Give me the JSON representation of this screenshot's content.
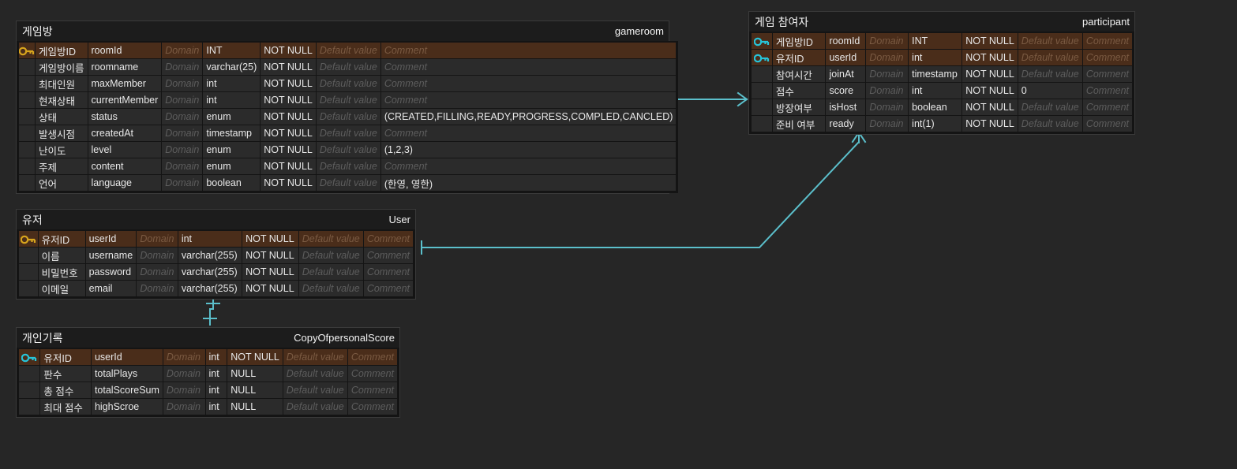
{
  "canvas": {
    "background": "#262626",
    "relation_color": "#5bbfcb",
    "pk_row_color": "#4a2d1a",
    "row_color": "#2b2b2b",
    "key_icon_gold": "#d8a51d",
    "key_icon_cyan": "#27c4d9"
  },
  "column_headers": {
    "domain": "Domain",
    "default_value": "Default value",
    "comment": "Comment"
  },
  "entities": [
    {
      "id": "gameroom",
      "logical_name": "게임방",
      "physical_name": "gameroom",
      "columns": [
        {
          "key": "pk-gold",
          "logical": "게임방ID",
          "physical": "roomId",
          "domain": "Domain",
          "type": "INT",
          "nullable": "NOT NULL",
          "default": "Default value",
          "default_is_placeholder": true,
          "comment": "Comment",
          "comment_is_placeholder": true
        },
        {
          "key": "none",
          "logical": "게임방이름",
          "physical": "roomname",
          "domain": "Domain",
          "type": "varchar(25)",
          "nullable": "NOT NULL",
          "default": "Default value",
          "default_is_placeholder": true,
          "comment": "Comment",
          "comment_is_placeholder": true
        },
        {
          "key": "none",
          "logical": "최대인원",
          "physical": "maxMember",
          "domain": "Domain",
          "type": "int",
          "nullable": "NOT NULL",
          "default": "Default value",
          "default_is_placeholder": true,
          "comment": "Comment",
          "comment_is_placeholder": true
        },
        {
          "key": "none",
          "logical": "현재상태",
          "physical": "currentMember",
          "domain": "Domain",
          "type": "int",
          "nullable": "NOT NULL",
          "default": "Default value",
          "default_is_placeholder": true,
          "comment": "Comment",
          "comment_is_placeholder": true
        },
        {
          "key": "none",
          "logical": "상태",
          "physical": "status",
          "domain": "Domain",
          "type": "enum",
          "nullable": "NOT NULL",
          "default": "Default value",
          "default_is_placeholder": true,
          "comment": "(CREATED,FILLING,READY,PROGRESS,COMPLED,CANCLED)",
          "comment_is_placeholder": false
        },
        {
          "key": "none",
          "logical": "발생시점",
          "physical": "createdAt",
          "domain": "Domain",
          "type": "timestamp",
          "nullable": "NOT NULL",
          "default": "Default value",
          "default_is_placeholder": true,
          "comment": "Comment",
          "comment_is_placeholder": true
        },
        {
          "key": "none",
          "logical": "난이도",
          "physical": "level",
          "domain": "Domain",
          "type": "enum",
          "nullable": "NOT NULL",
          "default": "Default value",
          "default_is_placeholder": true,
          "comment": "(1,2,3)",
          "comment_is_placeholder": false
        },
        {
          "key": "none",
          "logical": "주제",
          "physical": "content",
          "domain": "Domain",
          "type": "enum",
          "nullable": "NOT NULL",
          "default": "Default value",
          "default_is_placeholder": true,
          "comment": "Comment",
          "comment_is_placeholder": true
        },
        {
          "key": "none",
          "logical": "언어",
          "physical": "language",
          "domain": "Domain",
          "type": "boolean",
          "nullable": "NOT NULL",
          "default": "Default value",
          "default_is_placeholder": true,
          "comment": "(한영, 영한)",
          "comment_is_placeholder": false
        }
      ]
    },
    {
      "id": "participant",
      "logical_name": "게임 참여자",
      "physical_name": "participant",
      "columns": [
        {
          "key": "pk-cyan",
          "logical": "게임방ID",
          "physical": "roomId",
          "domain": "Domain",
          "type": "INT",
          "nullable": "NOT NULL",
          "default": "Default value",
          "default_is_placeholder": true,
          "comment": "Comment",
          "comment_is_placeholder": true
        },
        {
          "key": "pk-cyan",
          "logical": "유저ID",
          "physical": "userId",
          "domain": "Domain",
          "type": "int",
          "nullable": "NOT NULL",
          "default": "Default value",
          "default_is_placeholder": true,
          "comment": "Comment",
          "comment_is_placeholder": true
        },
        {
          "key": "none",
          "logical": "참여시간",
          "physical": "joinAt",
          "domain": "Domain",
          "type": "timestamp",
          "nullable": "NOT NULL",
          "default": "Default value",
          "default_is_placeholder": true,
          "comment": "Comment",
          "comment_is_placeholder": true
        },
        {
          "key": "none",
          "logical": "점수",
          "physical": "score",
          "domain": "Domain",
          "type": "int",
          "nullable": "NOT NULL",
          "default": "0",
          "default_is_placeholder": false,
          "comment": "Comment",
          "comment_is_placeholder": true
        },
        {
          "key": "none",
          "logical": "방장여부",
          "physical": "isHost",
          "domain": "Domain",
          "type": "boolean",
          "nullable": "NOT NULL",
          "default": "Default value",
          "default_is_placeholder": true,
          "comment": "Comment",
          "comment_is_placeholder": true
        },
        {
          "key": "none",
          "logical": "준비 여부",
          "physical": "ready",
          "domain": "Domain",
          "type": "int(1)",
          "nullable": "NOT NULL",
          "default": "Default value",
          "default_is_placeholder": true,
          "comment": "Comment",
          "comment_is_placeholder": true
        }
      ]
    },
    {
      "id": "user",
      "logical_name": "유저",
      "physical_name": "User",
      "columns": [
        {
          "key": "pk-gold",
          "logical": "유저ID",
          "physical": "userId",
          "domain": "Domain",
          "type": "int",
          "nullable": "NOT NULL",
          "default": "Default value",
          "default_is_placeholder": true,
          "comment": "Comment",
          "comment_is_placeholder": true
        },
        {
          "key": "none",
          "logical": "이름",
          "physical": "username",
          "domain": "Domain",
          "type": "varchar(255)",
          "nullable": "NOT NULL",
          "default": "Default value",
          "default_is_placeholder": true,
          "comment": "Comment",
          "comment_is_placeholder": true
        },
        {
          "key": "none",
          "logical": "비밀번호",
          "physical": "password",
          "domain": "Domain",
          "type": "varchar(255)",
          "nullable": "NOT NULL",
          "default": "Default value",
          "default_is_placeholder": true,
          "comment": "Comment",
          "comment_is_placeholder": true
        },
        {
          "key": "none",
          "logical": "이메일",
          "physical": "email",
          "domain": "Domain",
          "type": "varchar(255)",
          "nullable": "NOT NULL",
          "default": "Default value",
          "default_is_placeholder": true,
          "comment": "Comment",
          "comment_is_placeholder": true
        }
      ]
    },
    {
      "id": "score",
      "logical_name": "개인기록",
      "physical_name": "CopyOfpersonalScore",
      "columns": [
        {
          "key": "pk-cyan",
          "logical": "유저ID",
          "physical": "userId",
          "domain": "Domain",
          "type": "int",
          "nullable": "NOT NULL",
          "default": "Default value",
          "default_is_placeholder": true,
          "comment": "Comment",
          "comment_is_placeholder": true
        },
        {
          "key": "none",
          "logical": "판수",
          "physical": "totalPlays",
          "domain": "Domain",
          "type": "int",
          "nullable": "NULL",
          "default": "Default value",
          "default_is_placeholder": true,
          "comment": "Comment",
          "comment_is_placeholder": true
        },
        {
          "key": "none",
          "logical": "총 점수",
          "physical": "totalScoreSum",
          "domain": "Domain",
          "type": "int",
          "nullable": "NULL",
          "default": "Default value",
          "default_is_placeholder": true,
          "comment": "Comment",
          "comment_is_placeholder": true
        },
        {
          "key": "none",
          "logical": "최대 점수",
          "physical": "highScroe",
          "domain": "Domain",
          "type": "int",
          "nullable": "NULL",
          "default": "Default value",
          "default_is_placeholder": true,
          "comment": "Comment",
          "comment_is_placeholder": true
        }
      ]
    }
  ],
  "relationships": [
    {
      "id": "gameroom-participant",
      "from": "gameroom",
      "to": "participant",
      "from_cardinality": "one",
      "to_cardinality": "many"
    },
    {
      "id": "user-participant",
      "from": "user",
      "to": "participant",
      "from_cardinality": "one",
      "to_cardinality": "many"
    },
    {
      "id": "user-score",
      "from": "user",
      "to": "score",
      "from_cardinality": "one",
      "to_cardinality": "one"
    }
  ]
}
